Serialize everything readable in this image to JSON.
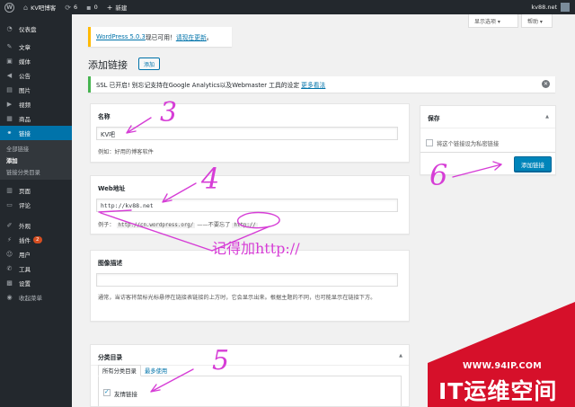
{
  "adminbar": {
    "site_name": "KV吧博客",
    "updates_count": "6",
    "comments_count": "0",
    "new_label": "新建",
    "user": "kv88.net"
  },
  "screen_meta": {
    "screen_options": "显示选项 ▾",
    "help": "帮助 ▾"
  },
  "sidebar": {
    "items": [
      {
        "label": "仪表盘",
        "icon": "dashboard-icon",
        "glyph": "◔"
      },
      {
        "label": "文章",
        "icon": "pin-icon",
        "glyph": "✎"
      },
      {
        "label": "媒体",
        "icon": "media-icon",
        "glyph": "▣"
      },
      {
        "label": "公告",
        "icon": "megaphone-icon",
        "glyph": "◀"
      },
      {
        "label": "图片",
        "icon": "image-icon",
        "glyph": "▤"
      },
      {
        "label": "视频",
        "icon": "video-icon",
        "glyph": "▶"
      },
      {
        "label": "商品",
        "icon": "product-icon",
        "glyph": "▦"
      },
      {
        "label": "链接",
        "icon": "link-icon",
        "glyph": "⚭"
      },
      {
        "label": "页面",
        "icon": "page-icon",
        "glyph": "▥"
      },
      {
        "label": "评论",
        "icon": "comment-icon",
        "glyph": "▭"
      },
      {
        "label": "外观",
        "icon": "appearance-icon",
        "glyph": "✐"
      },
      {
        "label": "插件",
        "icon": "plugin-icon",
        "glyph": "⚡",
        "badge": "2"
      },
      {
        "label": "用户",
        "icon": "user-icon",
        "glyph": "☺"
      },
      {
        "label": "工具",
        "icon": "tools-icon",
        "glyph": "✆"
      },
      {
        "label": "设置",
        "icon": "settings-icon",
        "glyph": "▩"
      },
      {
        "label": "收起菜单",
        "icon": "collapse-icon",
        "glyph": "◉"
      }
    ],
    "submenu": [
      "全部链接",
      "添加",
      "链接分类目录"
    ]
  },
  "notices": {
    "update_prefix": "WordPress 5.0.3",
    "update_middle": "现已可用！",
    "update_link": "请现在更新",
    "update_suffix": "。",
    "ssl_text": "SSL 已开启! 别忘记支持在Google Analytics以及Webmaster 工具的设定",
    "ssl_link": "更多看法"
  },
  "page": {
    "title": "添加链接",
    "add_new": "添加"
  },
  "name_box": {
    "title": "名称",
    "value": "KV吧",
    "hint": "例如：好用的博客软件"
  },
  "url_box": {
    "title": "Web地址",
    "value": "http://kv88.net",
    "hint_prefix": "例子：",
    "hint_example": "http://cn.wordpress.org/",
    "hint_dash": "——不要忘了",
    "hint_code": "http://"
  },
  "desc_box": {
    "title": "图像描述",
    "hint": "通常，当访客将鼠标光标悬停在链接表链接的上方时，它会显示出来。根据主题的不同，也可能显示在链接下方。"
  },
  "cat_box": {
    "title": "分类目录",
    "tab_all": "所有分类目录",
    "tab_popular": "最多使用",
    "item": "友情链接"
  },
  "save_box": {
    "title": "保存",
    "private_label": "将这个链接设为私密链接",
    "submit": "添加链接"
  },
  "annotations": {
    "n3": "3",
    "n4": "4",
    "n5": "5",
    "n6": "6",
    "remember": "记得加http://"
  },
  "watermark": {
    "url": "WWW.94IP.COM",
    "brand": "IT运维空间"
  },
  "colors": {
    "admin_dark": "#23282d",
    "accent_blue": "#0073aa",
    "button_blue": "#0085ba",
    "annotation": "#d63dd6",
    "watermark_red": "#d6102a"
  }
}
